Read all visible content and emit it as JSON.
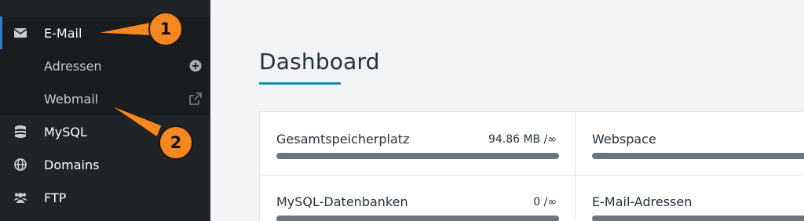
{
  "sidebar": {
    "items": [
      {
        "label": "E-Mail",
        "icon": "envelope-icon",
        "active": true
      },
      {
        "label": "Adressen",
        "icon": "plus-circle-icon",
        "sub": true
      },
      {
        "label": "Webmail",
        "icon": "external-link-icon",
        "sub": true
      },
      {
        "label": "MySQL",
        "icon": "database-icon"
      },
      {
        "label": "Domains",
        "icon": "globe-icon"
      },
      {
        "label": "FTP",
        "icon": "users-icon"
      }
    ]
  },
  "main": {
    "title": "Dashboard",
    "stats": [
      {
        "label": "Gesamtspeicherplatz",
        "value": "94.86 MB /∞"
      },
      {
        "label": "Webspace",
        "value": ""
      },
      {
        "label": "MySQL-Datenbanken",
        "value": "0 /∞"
      },
      {
        "label": "E-Mail-Adressen",
        "value": ""
      }
    ]
  },
  "annotations": {
    "badge_1": "1",
    "badge_2": "2"
  },
  "colors": {
    "sidebar_bg": "#202428",
    "accent": "#1f86b0",
    "annotation": "#f6881f",
    "bar": "#6e767d"
  }
}
